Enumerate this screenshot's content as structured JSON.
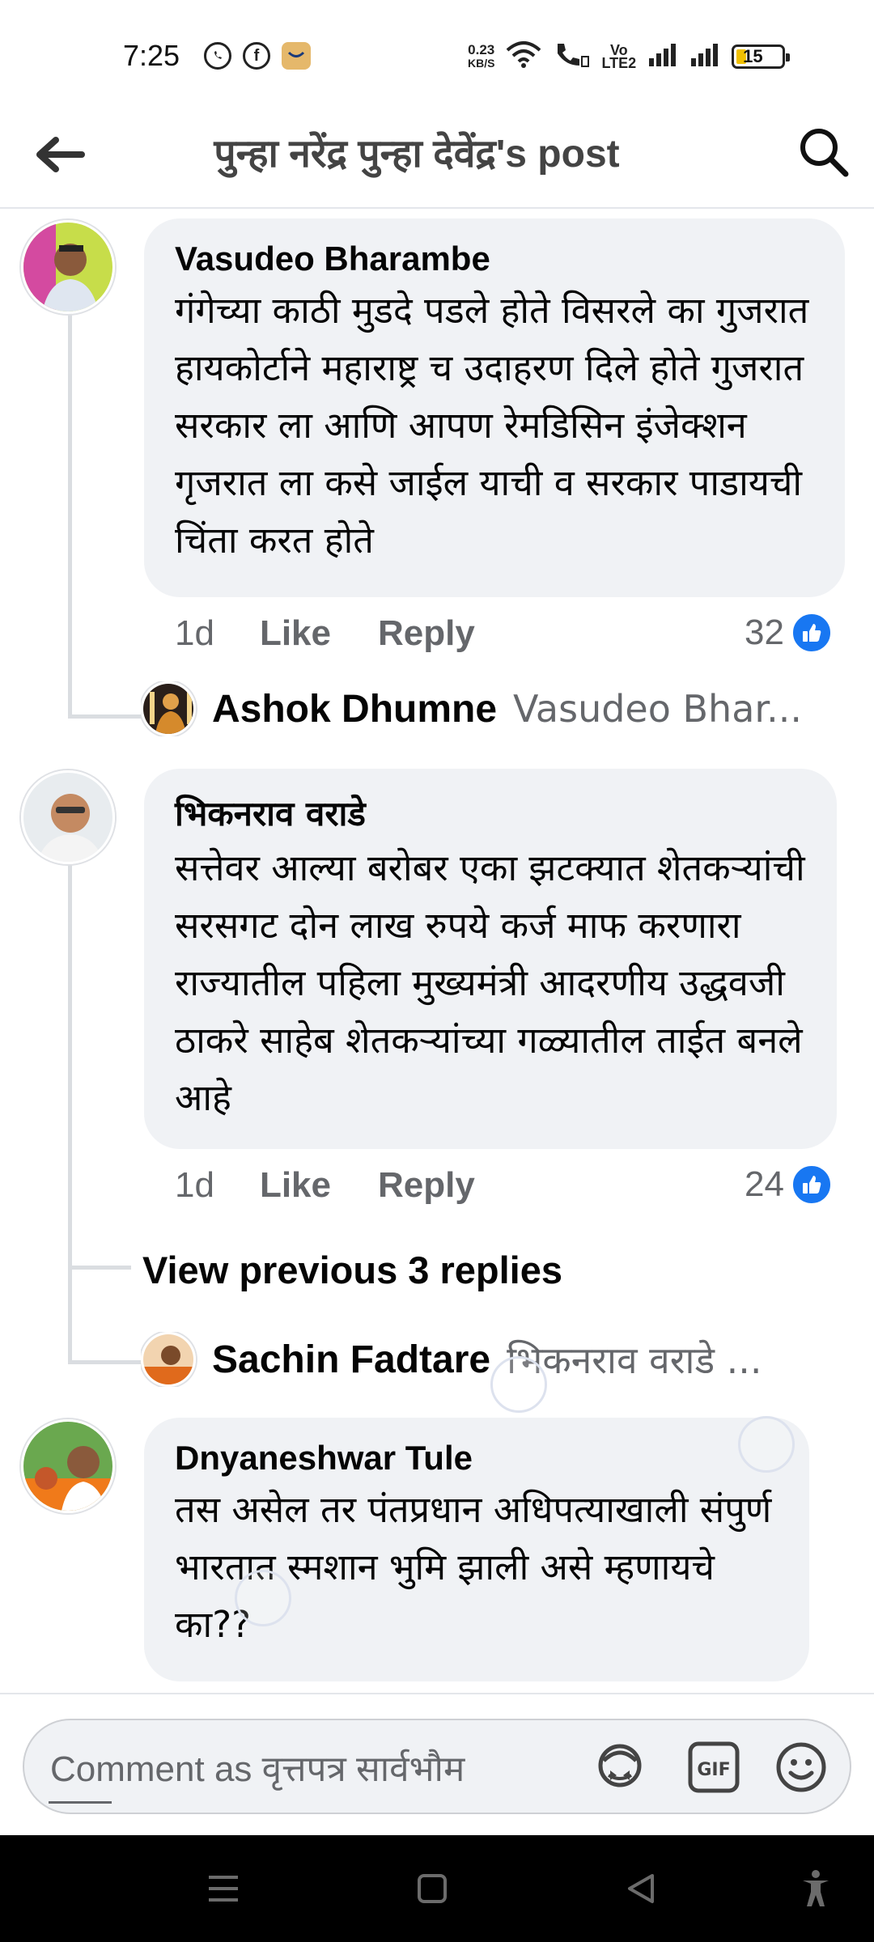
{
  "status_bar": {
    "time": "7:25",
    "speed_value": "0.23",
    "speed_unit": "KB/S",
    "volte_top": "Vo",
    "volte_bottom": "LTE2",
    "battery": "15"
  },
  "header": {
    "title": "पुन्हा नरेंद्र पुन्हा देवेंद्र's post"
  },
  "comments": [
    {
      "author": "Vasudeo Bharambe",
      "text": "गंगेच्या काठी मुडदे पडले होते विसरले का गुजरात हायकोर्टाने महाराष्ट्र च उदाहरण दिले होते गुजरात सरकार ला आणि आपण रेमडिसिन इंजेक्शन गृजरात ला कसे जाईल याची व सरकार पाडायची चिंता करत होते",
      "time": "1d",
      "like_label": "Like",
      "reply_label": "Reply",
      "reaction_count": "32",
      "reply_preview": {
        "author": "Ashok Dhumne",
        "text": "Vasudeo Bhar..."
      }
    },
    {
      "author": "भिकनराव वराडे",
      "text": "सत्तेवर आल्या बरोबर एका झटक्यात शेतकऱ्यांची सरसगट दोन लाख रुपये कर्ज माफ करणारा राज्यातील पहिला मुख्यमंत्री आदरणीय उद्धवजी ठाकरे साहेब शेतकऱ्यांच्या गळ्यातील ताईत बनले आहे",
      "time": "1d",
      "like_label": "Like",
      "reply_label": "Reply",
      "reaction_count": "24",
      "view_previous": "View previous 3 replies",
      "reply_preview": {
        "author": "Sachin Fadtare",
        "text": "भिकनराव वराडे ..."
      }
    },
    {
      "author": "Dnyaneshwar Tule",
      "text": "तस असेल तर पंतप्रधान अधिपत्याखाली संपुर्ण भारतात स्मशान भुमि झाली असे म्हणायचे का??"
    }
  ],
  "composer": {
    "placeholder": "Comment as वृत्तपत्र सार्वभौम"
  },
  "colors": {
    "like_blue": "#1877f2",
    "bubble_bg": "#f0f2f5",
    "secondary_text": "#65676b"
  }
}
